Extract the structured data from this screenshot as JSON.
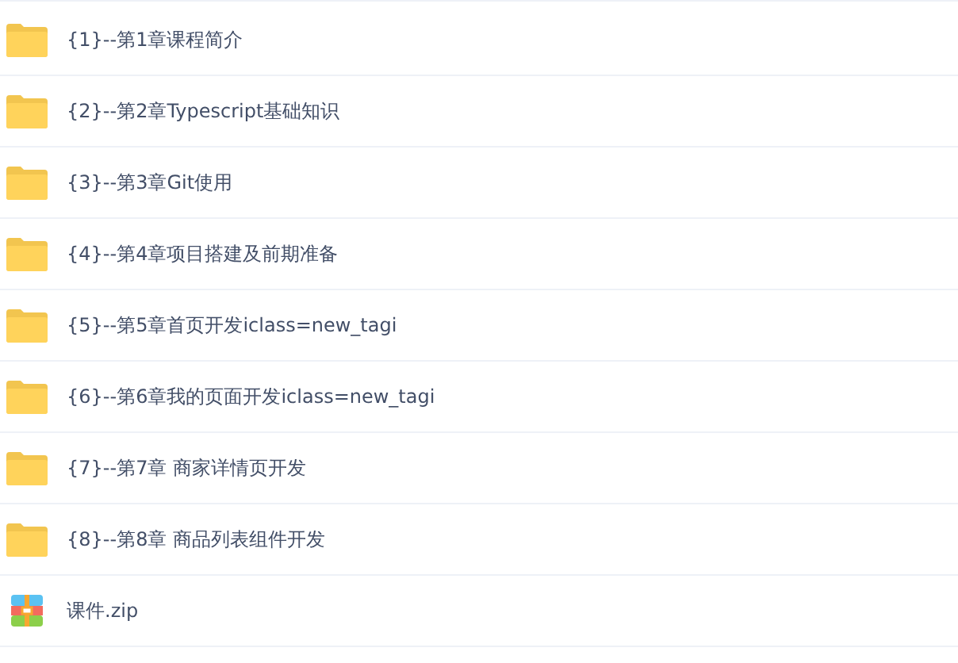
{
  "files": [
    {
      "kind": "folder",
      "name": "{1}--第1章课程简介"
    },
    {
      "kind": "folder",
      "name": "{2}--第2章Typescript基础知识"
    },
    {
      "kind": "folder",
      "name": "{3}--第3章Git使用"
    },
    {
      "kind": "folder",
      "name": "{4}--第4章项目搭建及前期准备"
    },
    {
      "kind": "folder",
      "name": "{5}--第5章首页开发iclass=new_tagi"
    },
    {
      "kind": "folder",
      "name": "{6}--第6章我的页面开发iclass=new_tagi"
    },
    {
      "kind": "folder",
      "name": "{7}--第7章 商家详情页开发"
    },
    {
      "kind": "folder",
      "name": "{8}--第8章 商品列表组件开发"
    },
    {
      "kind": "zip",
      "name": "课件.zip"
    }
  ]
}
